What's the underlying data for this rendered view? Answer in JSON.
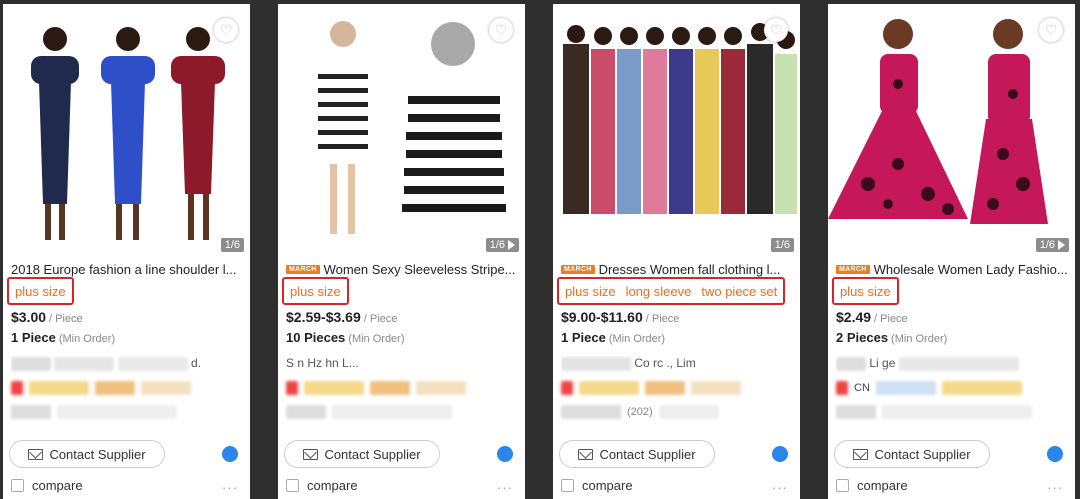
{
  "products": [
    {
      "title": "2018 Europe fashion a line shoulder l...",
      "badge": "",
      "tags": [
        "plus size"
      ],
      "price": "$3.00",
      "price_unit": "/ Piece",
      "moq_qty": "1 Piece",
      "moq_note": "(Min Order)",
      "supplier": "d.",
      "image_count": "1/6",
      "country": "",
      "rating_text": "",
      "contact_label": "Contact Supplier",
      "compare_label": "compare",
      "icons": {
        "favorite": "heart-icon",
        "contact": "mail-icon",
        "chat": "chat-icon"
      }
    },
    {
      "title": "Women Sexy Sleeveless Stripe...",
      "badge": "MARCH",
      "tags": [
        "plus size"
      ],
      "price": "$2.59-$3.69",
      "price_unit": "/ Piece",
      "moq_qty": "10 Pieces",
      "moq_note": "(Min Order)",
      "supplier": "S        n Hz hn           L...",
      "image_count": "1/6",
      "country": "",
      "rating_text": "",
      "contact_label": "Contact Supplier",
      "compare_label": "compare",
      "icons": {
        "favorite": "heart-icon",
        "contact": "mail-icon",
        "chat": "chat-icon"
      }
    },
    {
      "title": "Dresses Women fall clothing l...",
      "badge": "MARCH",
      "tags": [
        "plus size",
        "long sleeve",
        "two piece set"
      ],
      "price": "$9.00-$11.60",
      "price_unit": "/ Piece",
      "moq_qty": "1 Piece",
      "moq_note": "(Min Order)",
      "supplier": "Co        rc     ., Lim",
      "image_count": "1/6",
      "country": "",
      "rating_text": "(202)",
      "contact_label": "Contact Supplier",
      "compare_label": "compare",
      "icons": {
        "favorite": "heart-icon",
        "contact": "mail-icon",
        "chat": "chat-icon"
      }
    },
    {
      "title": "Wholesale Women Lady Fashio...",
      "badge": "MARCH",
      "tags": [
        "plus size"
      ],
      "price": "$2.49",
      "price_unit": "/ Piece",
      "moq_qty": "2 Pieces",
      "moq_note": "(Min Order)",
      "supplier": "Li ge",
      "image_count": "1/6",
      "country": "CN",
      "rating_text": "",
      "contact_label": "Contact Supplier",
      "compare_label": "compare",
      "icons": {
        "favorite": "heart-icon",
        "contact": "mail-icon",
        "chat": "chat-icon"
      }
    }
  ],
  "colors": {
    "tag_text": "#f06b1d",
    "highlight_border": "#d9252a",
    "badge_bg": "#f07c22",
    "chat_blue": "#2a86e8"
  }
}
